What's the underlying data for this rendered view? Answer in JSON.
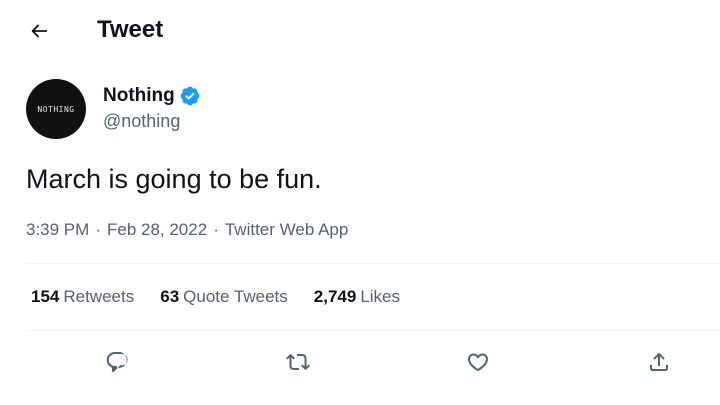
{
  "header": {
    "title": "Tweet",
    "back_icon": "arrow-left-icon"
  },
  "author": {
    "avatar_text": "NOTHING",
    "display_name": "Nothing",
    "verified_icon": "verified-badge-icon",
    "handle": "@nothing"
  },
  "tweet": {
    "text": "March is going to be fun.",
    "time": "3:39 PM",
    "separator": "·",
    "date": "Feb 28, 2022",
    "source": "Twitter Web App"
  },
  "stats": {
    "retweets_count": "154",
    "retweets_label": "Retweets",
    "quotes_count": "63",
    "quotes_label": "Quote Tweets",
    "likes_count": "2,749",
    "likes_label": "Likes"
  },
  "actions": [
    {
      "icon": "reply-icon"
    },
    {
      "icon": "retweet-icon"
    },
    {
      "icon": "like-icon"
    },
    {
      "icon": "share-icon"
    }
  ],
  "colors": {
    "text_primary": "#0f1419",
    "text_secondary": "#536471",
    "verified_blue": "#1d9bf0",
    "divider": "#eff3f4"
  }
}
